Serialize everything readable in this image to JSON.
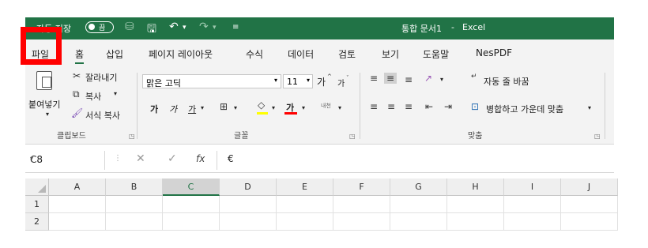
{
  "app": {
    "autosave_label": "자동 저장",
    "autosave_state": "끔",
    "doc_title": "통합 문서1",
    "separator": "-",
    "app_name": "Excel",
    "brand_color": "#217346",
    "highlight_color": "#ff0000"
  },
  "tabs": [
    "파일",
    "홈",
    "삽입",
    "페이지 레이아웃",
    "수식",
    "데이터",
    "검토",
    "보기",
    "도움말",
    "NesPDF"
  ],
  "ribbon": {
    "clipboard": {
      "paste": "붙여넣기",
      "cut": "잘라내기",
      "copy": "복사",
      "format_painter": "서식 복사",
      "group": "클립보드"
    },
    "font": {
      "font_name": "맑은 고딕",
      "font_size": "11",
      "grow": "가",
      "shrink": "가",
      "bold": "가",
      "italic": "가",
      "underline": "가",
      "font_color_glyph": "가",
      "phonetic": "내천",
      "group": "글꼴",
      "highlight_bar": "#ffff00",
      "font_bar": "#ff0000"
    },
    "alignment": {
      "wrap_text": "자동 줄 바꿈",
      "merge_center": "병합하고 가운데 맞춤",
      "group": "맞춤"
    }
  },
  "formula_bar": {
    "name_box": "C8",
    "fx": "fx",
    "content": "€"
  },
  "sheet": {
    "columns": [
      "A",
      "B",
      "C",
      "D",
      "E",
      "F",
      "G",
      "H",
      "I",
      "J"
    ],
    "selected_column": "C",
    "rows": [
      "1",
      "2"
    ]
  }
}
